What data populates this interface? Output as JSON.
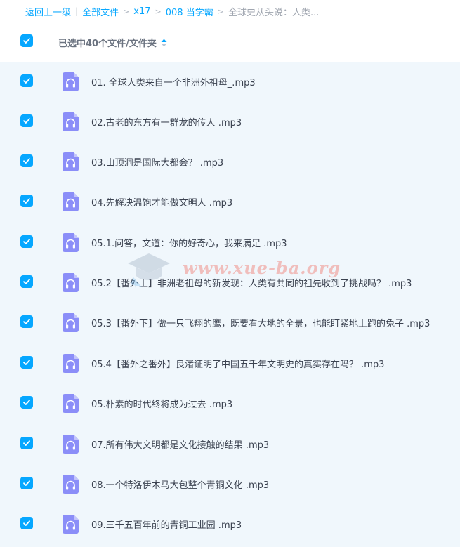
{
  "breadcrumb": {
    "back": "返回上一级",
    "all_files": "全部文件",
    "folder1": "x17",
    "folder2": "008 当学霸",
    "current": "全球史从头说：人类..."
  },
  "header": {
    "selection_label": "已选中40个文件/文件夹"
  },
  "watermark": {
    "text": "www.xue-ba.org"
  },
  "colors": {
    "accent": "#06a7ff",
    "list_background": "#f0f7fc",
    "audio_icon": "#8b8ef8"
  },
  "files": [
    {
      "name": "01. 全球人类来自一个非洲外祖母_.mp3",
      "icon": "audio-file-icon",
      "checked": true
    },
    {
      "name": "02.古老的东方有一群龙的传人 .mp3",
      "icon": "audio-file-icon",
      "checked": true
    },
    {
      "name": "03.山顶洞是国际大都会？ .mp3",
      "icon": "audio-file-icon",
      "checked": true
    },
    {
      "name": "04.先解决温饱才能做文明人 .mp3",
      "icon": "audio-file-icon",
      "checked": true
    },
    {
      "name": "05.1.问答，文道：你的好奇心，我来满足 .mp3",
      "icon": "audio-file-icon",
      "checked": true
    },
    {
      "name": "05.2【番外上】非洲老祖母的新发现：人类有共同的祖先收到了挑战吗？ .mp3",
      "icon": "audio-file-icon",
      "checked": true
    },
    {
      "name": "05.3【番外下】做一只飞翔的鹰，既要看大地的全景，也能盯紧地上跑的兔子 .mp3",
      "icon": "audio-file-icon",
      "checked": true
    },
    {
      "name": "05.4【番外之番外】良渚证明了中国五千年文明史的真实存在吗？ .mp3",
      "icon": "audio-file-icon",
      "checked": true
    },
    {
      "name": "05.朴素的时代终将成为过去 .mp3",
      "icon": "audio-file-icon",
      "checked": true
    },
    {
      "name": "07.所有伟大文明都是文化接触的结果 .mp3",
      "icon": "audio-file-icon",
      "checked": true
    },
    {
      "name": "08.一个特洛伊木马大包整个青铜文化 .mp3",
      "icon": "audio-file-icon",
      "checked": true
    },
    {
      "name": "09.三千五百年前的青铜工业园 .mp3",
      "icon": "audio-file-icon",
      "checked": true
    }
  ]
}
